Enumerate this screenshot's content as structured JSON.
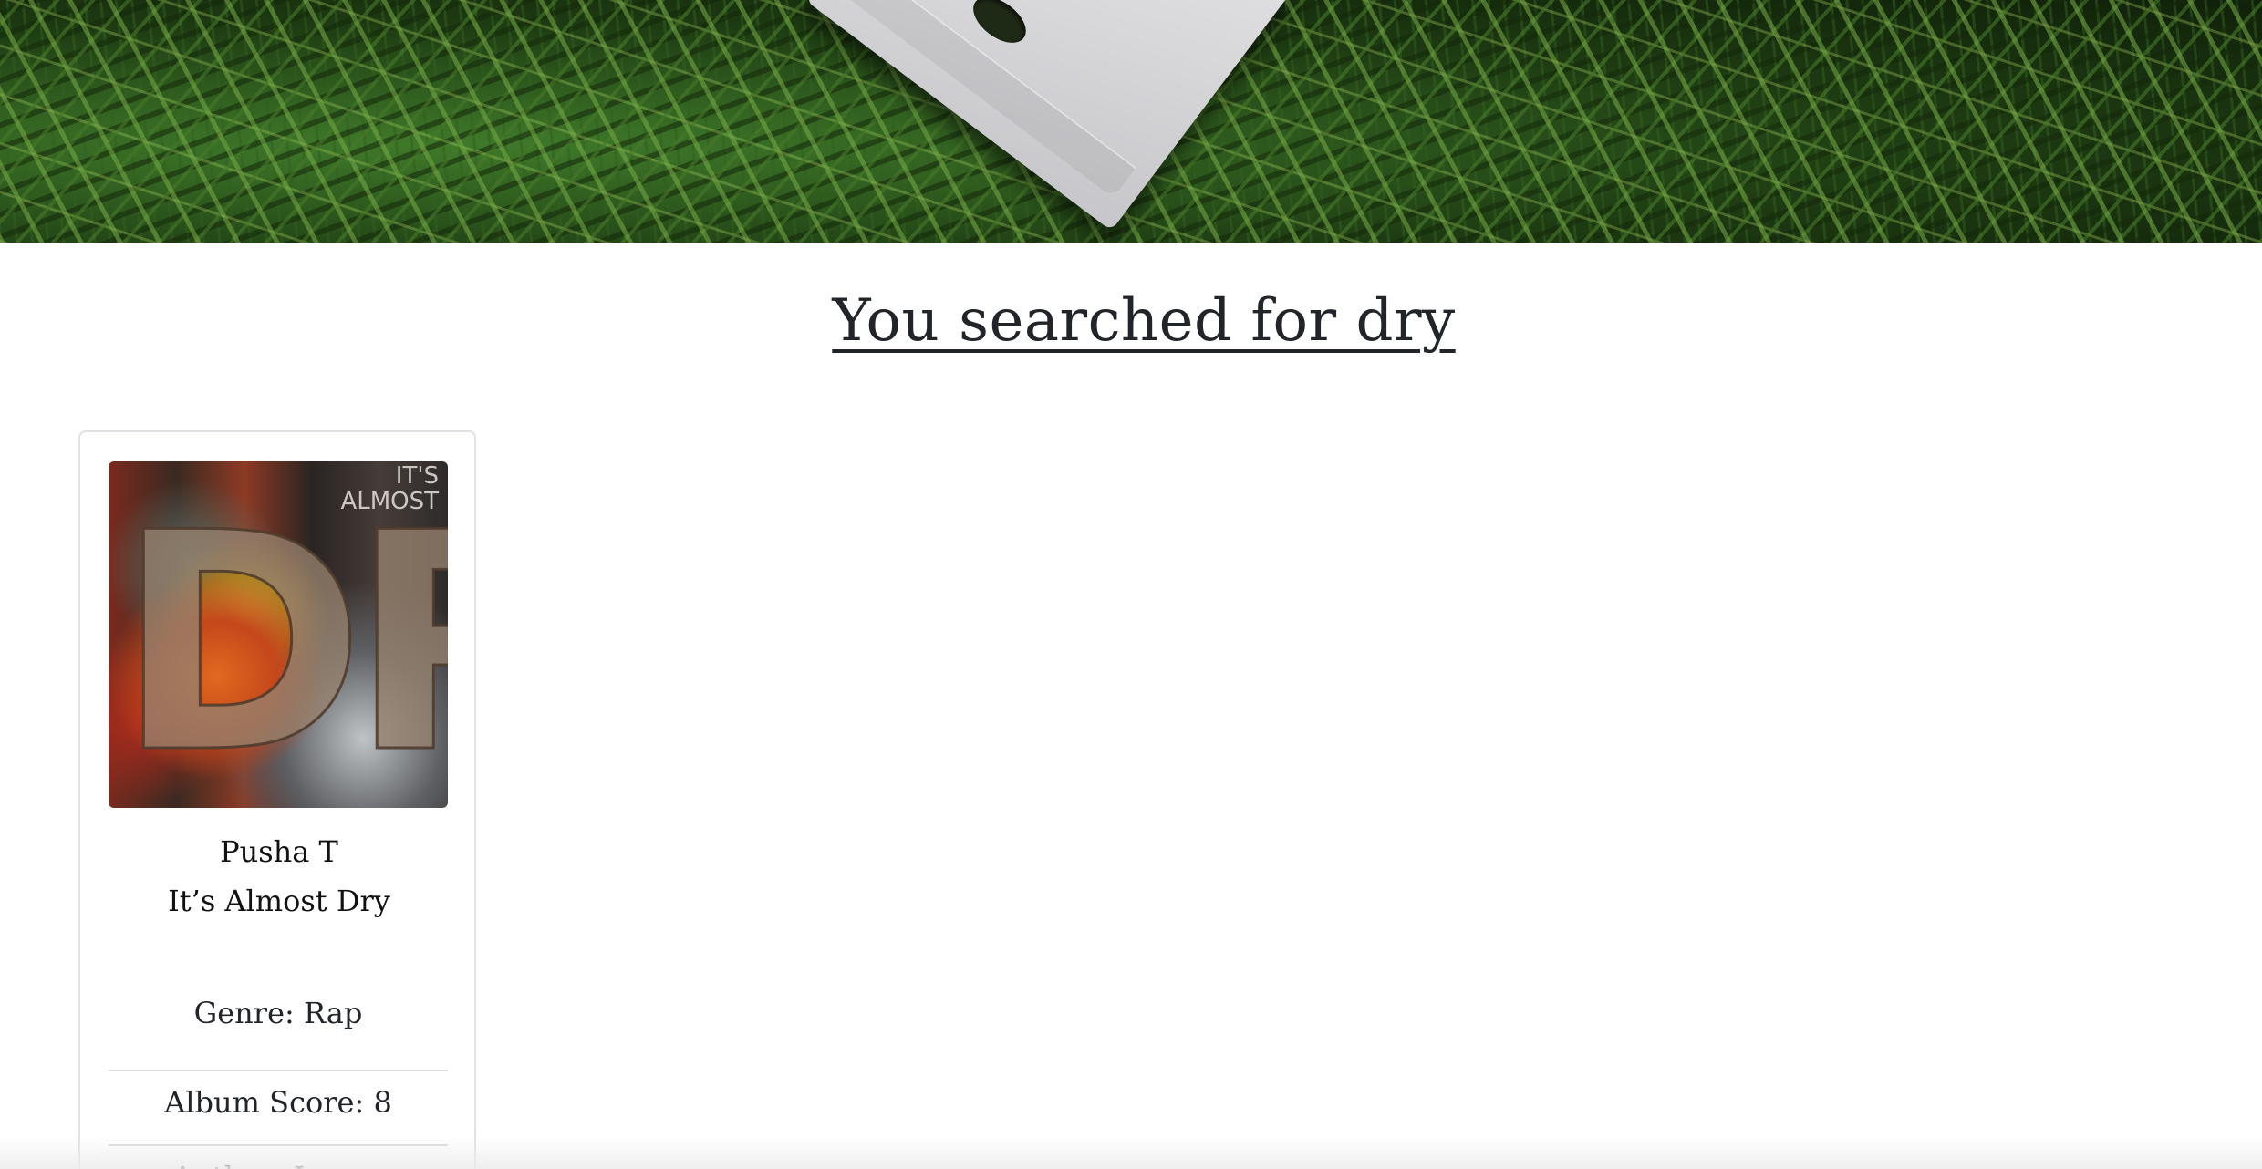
{
  "search": {
    "heading": "You searched for dry"
  },
  "results": [
    {
      "cover_text": "DRY",
      "cover_small_text": "IT'S\nALMOST",
      "artist": "Pusha T",
      "album": "It’s Almost Dry",
      "genre_line": "Genre: Rap",
      "score_line": "Album Score: 8",
      "author_line": "Author: Lenny"
    }
  ]
}
